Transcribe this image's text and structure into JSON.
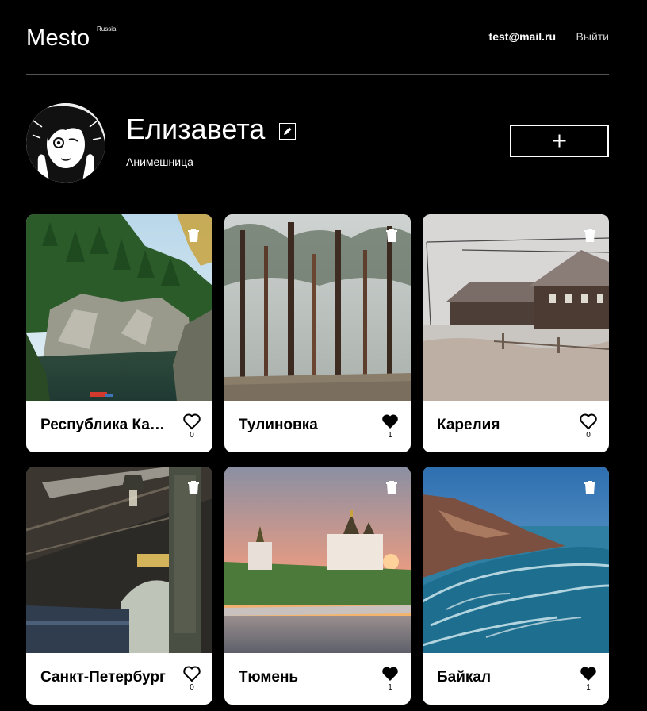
{
  "header": {
    "logo": "Mesto",
    "logo_sup": "Russia",
    "email": "test@mail.ru",
    "logout": "Выйти"
  },
  "profile": {
    "name": "Елизавета",
    "about": "Анимешница"
  },
  "cards": [
    {
      "title": "Республика Карелия",
      "likes": "0",
      "liked": false
    },
    {
      "title": "Тулиновка",
      "likes": "1",
      "liked": true
    },
    {
      "title": "Карелия",
      "likes": "0",
      "liked": false
    },
    {
      "title": "Санкт-Петербург",
      "likes": "0",
      "liked": false
    },
    {
      "title": "Тюмень",
      "likes": "1",
      "liked": true
    },
    {
      "title": "Байкал",
      "likes": "1",
      "liked": true
    }
  ]
}
